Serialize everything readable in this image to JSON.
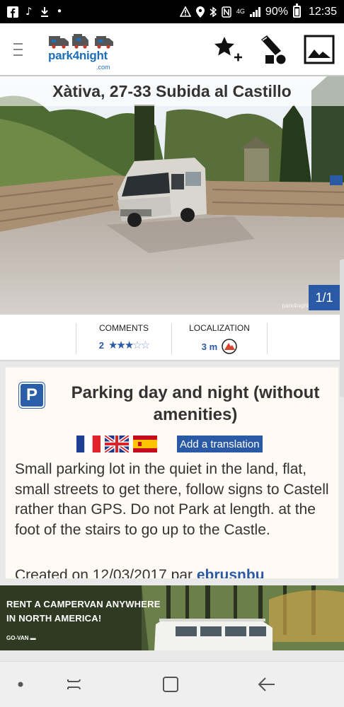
{
  "status_bar": {
    "battery": "90%",
    "time": "12:35",
    "network": "4G"
  },
  "header": {
    "logo_text": "park4night",
    "logo_suffix": ".com"
  },
  "place": {
    "title": "Xàtiva, 27-33 Subida al Castillo",
    "photo_counter": "1/1",
    "watermark": "park4night"
  },
  "info": {
    "comments_label": "COMMENTS",
    "comments_count": "2",
    "rating": 3,
    "rating_max": 5,
    "localization_label": "LOCALIZATION",
    "localization_value": "3 m"
  },
  "details": {
    "type_icon": "P",
    "type_title": "Parking day and night (without amenities)",
    "languages": [
      "fr",
      "gb",
      "es"
    ],
    "translate_label": "Add a translation",
    "description": "Small parking lot in the quiet in the land, flat, small streets to get there, follow signs to Castell rather than GPS. Do not Park at length. at the foot of the stairs to go up to the Castle.",
    "created_prefix": "Created on 12/03/2017 par",
    "created_by": "ebrusnbu"
  },
  "ad": {
    "headline_line1": "RENT A CAMPERVAN ANYWHERE",
    "headline_line2": "IN NORTH AMERICA!",
    "brand": "GO-VAN"
  },
  "colors": {
    "accent": "#2a5aa5",
    "text": "#333333"
  }
}
